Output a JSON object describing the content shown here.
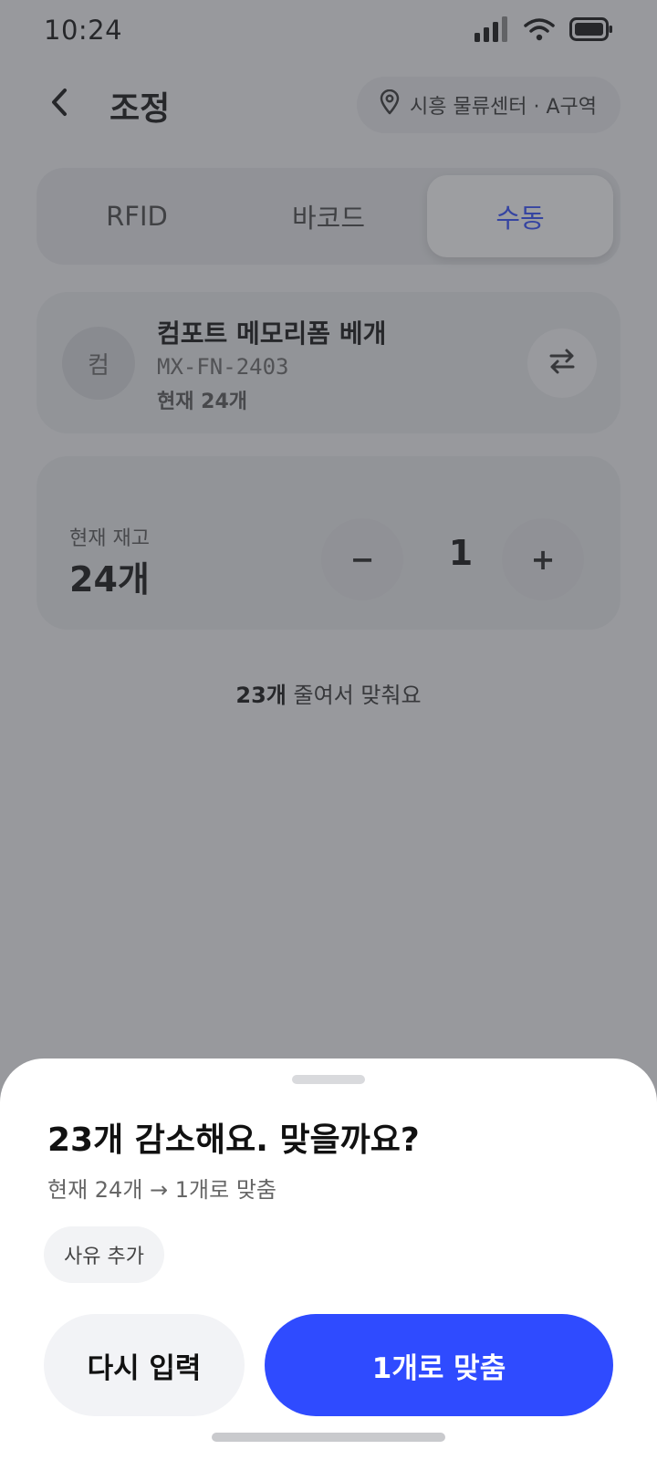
{
  "status_bar": {
    "time": "10:24"
  },
  "header": {
    "title": "조정",
    "location": "시흥 물류센터 · A구역"
  },
  "segments": [
    {
      "label": "RFID",
      "active": false
    },
    {
      "label": "바코드",
      "active": false
    },
    {
      "label": "수동",
      "active": true
    }
  ],
  "product": {
    "avatar_text": "컴",
    "name": "컴포트 메모리폼 베개",
    "sku": "MX-FN-2403",
    "stock_text": "현재 24개"
  },
  "quantity": {
    "stock_label": "현재 재고",
    "stock_value": "24개",
    "minus": "−",
    "value": "1",
    "plus": "+"
  },
  "hint": {
    "count": "23개",
    "rest": " 줄여서 맞춰요"
  },
  "sheet": {
    "title": "23개 감소해요. 맞을까요?",
    "subtitle": "현재 24개 → 1개로 맞춤",
    "reason_chip": "사유 추가",
    "retry_label": "다시 입력",
    "confirm_label": "1개로 맞춤"
  },
  "colors": {
    "accent": "#2f4bff",
    "overlay": "#3c3e44"
  }
}
